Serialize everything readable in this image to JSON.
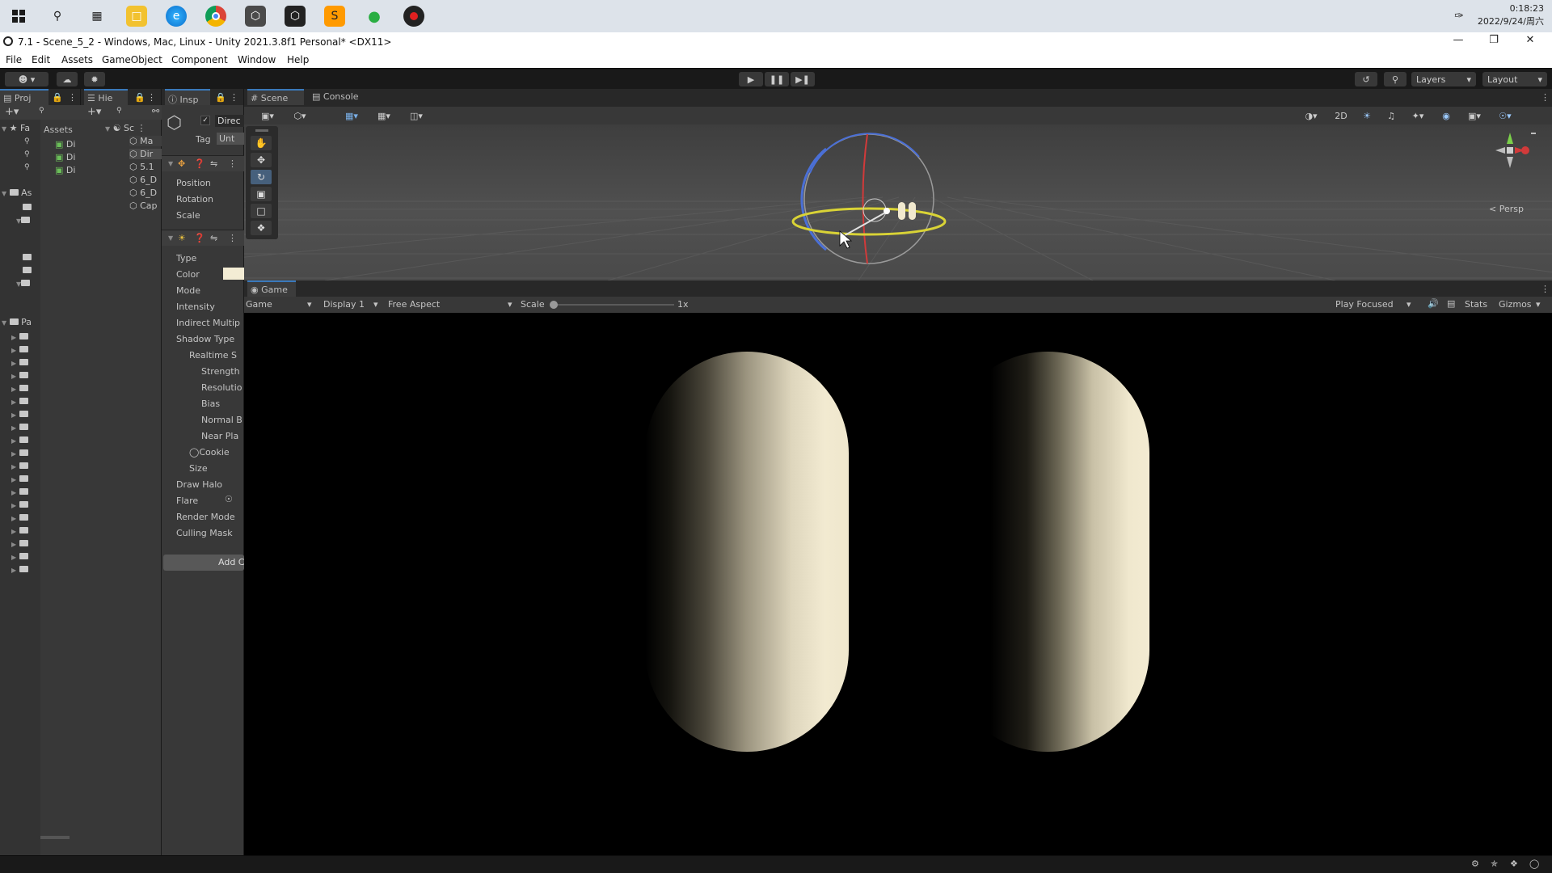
{
  "taskbar": {
    "clock_time": "0:18:23",
    "clock_date": "2022/9/24/周六"
  },
  "window": {
    "title": "7.1 - Scene_5_2 - Windows, Mac, Linux - Unity 2021.3.8f1 Personal* <DX11>"
  },
  "menu": [
    "File",
    "Edit",
    "Assets",
    "GameObject",
    "Component",
    "Window",
    "Help"
  ],
  "toolbar": {
    "layers_label": "Layers",
    "layout_label": "Layout"
  },
  "project": {
    "tab": "Proj",
    "favorites_label": "Fa",
    "assets_header": "Assets",
    "assets_label": "As",
    "packages_label": "Pa",
    "fav_items": [
      "Di",
      "Di",
      "Di"
    ]
  },
  "hierarchy": {
    "tab": "Hie",
    "scene_label": "Sc",
    "items": [
      "Ma",
      "Dir",
      "5.1",
      "6_D",
      "6_D",
      "Cap"
    ]
  },
  "inspector": {
    "tab": "Insp",
    "object_name": "Direc",
    "tag_label": "Tag",
    "tag_value": "Unt",
    "transform_fields": [
      "Position",
      "Rotation",
      "Scale"
    ],
    "light_fields": [
      "Type",
      "Color",
      "Mode",
      "Intensity",
      "Indirect Multip",
      "Shadow Type",
      "Realtime S",
      "Strength",
      "Resolutio",
      "Bias",
      "Normal B",
      "Near Pla",
      "Cookie",
      "Size",
      "Draw Halo",
      "Flare",
      "Render Mode",
      "Culling Mask"
    ],
    "add_component": "Add C",
    "color_swatch": "#f3ecd4"
  },
  "scene": {
    "tab_scene": "Scene",
    "tab_console": "Console",
    "mode_2d": "2D",
    "persp_label": "< Persp"
  },
  "game": {
    "tab": "Game",
    "view_select": "Game",
    "display_select": "Display 1",
    "aspect_select": "Free Aspect",
    "scale_label": "Scale",
    "scale_value": "1x",
    "play_mode_select": "Play Focused",
    "stats": "Stats",
    "gizmos": "Gizmos"
  },
  "colors": {
    "capsule_light": "#f1e9cf",
    "gizmo_yellow": "#d9d336",
    "gizmo_blue": "#4a6fd6",
    "gizmo_red": "#d13a3a",
    "accent_blue": "#3a79bb"
  }
}
